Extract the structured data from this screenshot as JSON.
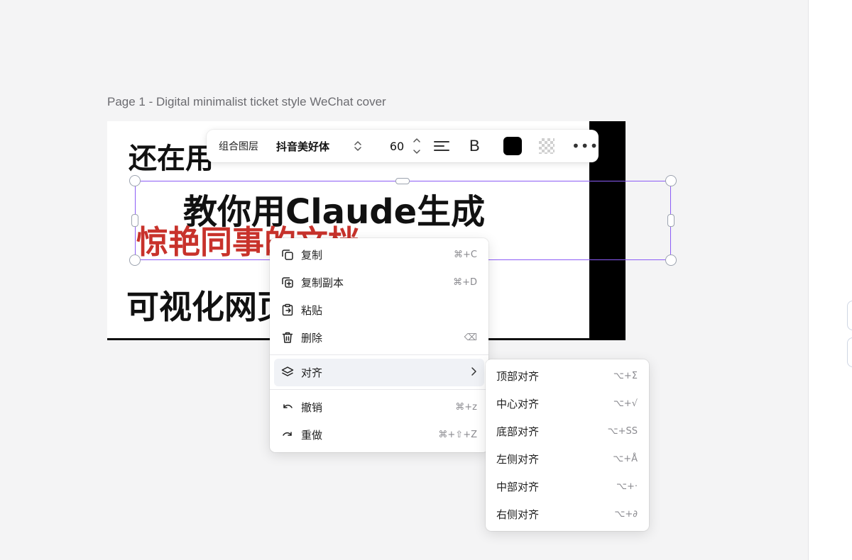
{
  "page": {
    "label": "Page 1 - Digital minimalist ticket style WeChat cover"
  },
  "canvas": {
    "headline_1": "还在用",
    "headline_2": "教你用Claude生成",
    "headline_3": "惊艳同事的文档",
    "headline_4": "可视化网页",
    "accent_color": "#c8322b"
  },
  "toolbar": {
    "group_label": "组合图层",
    "font_name": "抖音美好体",
    "font_size": "60",
    "bold_label": "B",
    "more_label": "•••",
    "text_color": "#000000"
  },
  "context_menu": {
    "items": [
      {
        "label": "复制",
        "shortcut": "⌘+C",
        "icon": "copy-icon"
      },
      {
        "label": "复制副本",
        "shortcut": "⌘+D",
        "icon": "duplicate-icon"
      },
      {
        "label": "粘贴",
        "shortcut": "",
        "icon": "paste-icon"
      },
      {
        "label": "删除",
        "shortcut": "⌫",
        "icon": "trash-icon"
      },
      {
        "label": "对齐",
        "shortcut": "",
        "icon": "layers-icon"
      },
      {
        "label": "撤销",
        "shortcut": "⌘+z",
        "icon": "undo-icon"
      },
      {
        "label": "重做",
        "shortcut": "⌘+⇧+Z",
        "icon": "redo-icon"
      }
    ]
  },
  "align_submenu": {
    "items": [
      {
        "label": "顶部对齐",
        "shortcut": "⌥+Σ"
      },
      {
        "label": "中心对齐",
        "shortcut": "⌥+√"
      },
      {
        "label": "底部对齐",
        "shortcut": "⌥+SS"
      },
      {
        "label": "左侧对齐",
        "shortcut": "⌥+Å"
      },
      {
        "label": "中部对齐",
        "shortcut": "⌥+·"
      },
      {
        "label": "右侧对齐",
        "shortcut": "⌥+∂"
      }
    ]
  }
}
